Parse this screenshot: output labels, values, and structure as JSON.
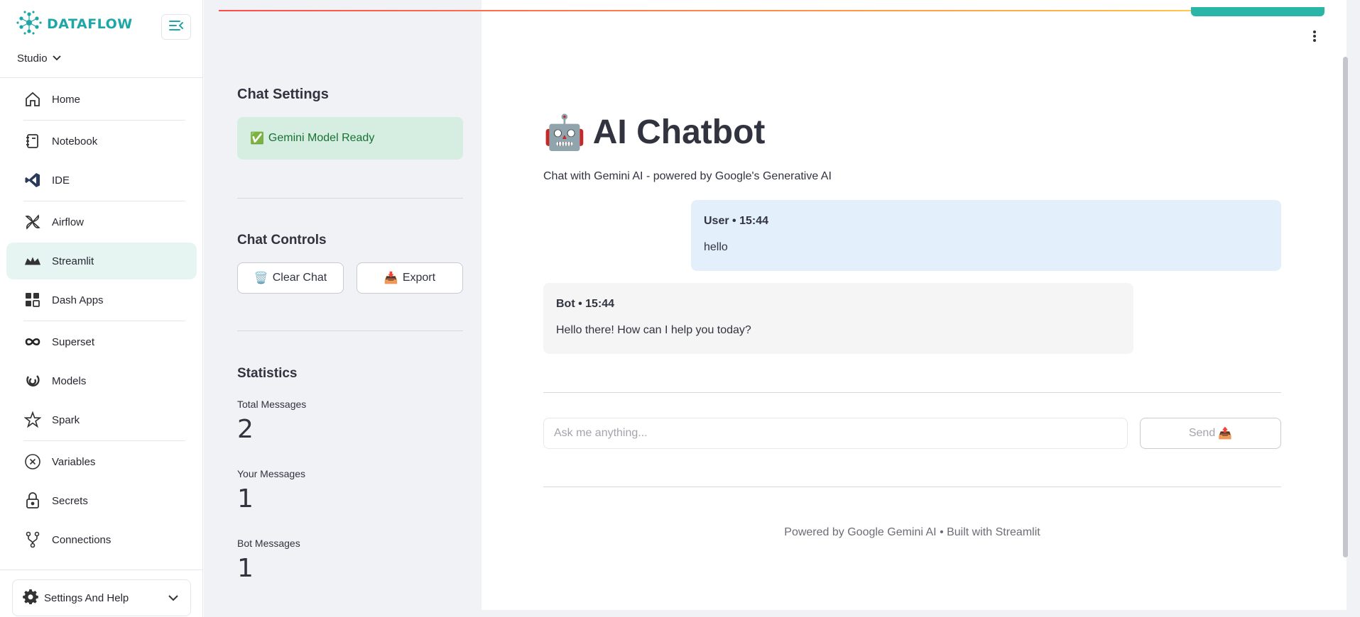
{
  "app": {
    "brand": "DATAFLOW",
    "workspace": "Studio",
    "accent": "#1fa6a6"
  },
  "sidebar": {
    "items": [
      {
        "label": "Home",
        "icon": "home-icon"
      },
      {
        "label": "Notebook",
        "icon": "notebook-icon"
      },
      {
        "label": "IDE",
        "icon": "vscode-icon"
      },
      {
        "label": "Airflow",
        "icon": "airflow-icon"
      },
      {
        "label": "Streamlit",
        "icon": "streamlit-icon",
        "active": true
      },
      {
        "label": "Dash Apps",
        "icon": "grid-icon"
      },
      {
        "label": "Superset",
        "icon": "infinity-icon"
      },
      {
        "label": "Models",
        "icon": "models-icon"
      },
      {
        "label": "Spark",
        "icon": "star-icon"
      },
      {
        "label": "Variables",
        "icon": "variable-icon"
      },
      {
        "label": "Secrets",
        "icon": "lock-icon"
      },
      {
        "label": "Connections",
        "icon": "connections-icon"
      }
    ],
    "settings_label": "Settings And Help"
  },
  "st_sidebar": {
    "settings_heading": "Chat Settings",
    "status_icon": "✅",
    "status_text": "Gemini Model Ready",
    "controls_heading": "Chat Controls",
    "clear_icon": "🗑️",
    "clear_label": "Clear Chat",
    "export_icon": "📥",
    "export_label": "Export",
    "stats_heading": "Statistics",
    "metrics": [
      {
        "label": "Total Messages",
        "value": "2"
      },
      {
        "label": "Your Messages",
        "value": "1"
      },
      {
        "label": "Bot Messages",
        "value": "1"
      }
    ]
  },
  "main": {
    "title_emoji": "🤖",
    "title": "AI Chatbot",
    "subtitle": "Chat with Gemini AI - powered by Google's Generative AI",
    "messages": [
      {
        "who": "User • 15:44",
        "text": "hello"
      },
      {
        "who": "Bot • 15:44",
        "text": "Hello there! How can I help you today?"
      }
    ],
    "input_placeholder": "Ask me anything...",
    "send_label": "Send",
    "send_icon": "📤",
    "footer": "Powered by Google Gemini AI • Built with Streamlit"
  }
}
